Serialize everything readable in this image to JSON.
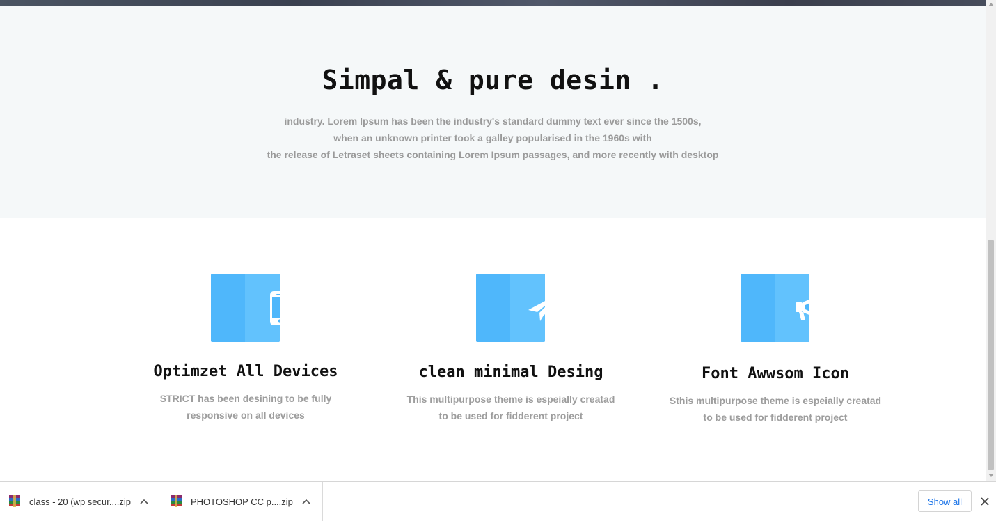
{
  "hero": {
    "title": "Simpal & pure desin .",
    "description": [
      "industry. Lorem Ipsum has been the industry's standard dummy text ever since the 1500s,",
      "when an unknown printer took a galley popularised in the 1960s with",
      "the release of Letraset sheets containing Lorem Ipsum passages, and more recently with desktop"
    ]
  },
  "features": [
    {
      "icon": "mobile-phone-icon",
      "title": "Optimzet All Devices",
      "lines": [
        "STRICT has been desining to be fully",
        "responsive on all devices"
      ]
    },
    {
      "icon": "paper-plane-icon",
      "title": "clean minimal Desing",
      "lines": [
        "This multipurpose theme is espeially creatad",
        "to be used for fidderent project"
      ]
    },
    {
      "icon": "bullhorn-icon",
      "title": "Font Awwsom Icon",
      "lines": [
        "Sthis multipurpose theme is espeially creatad",
        "to be used for fidderent project"
      ]
    }
  ],
  "colors": {
    "hero_bg": "#f5f8f9",
    "icon_box": "#4fb7fb",
    "icon_box_light": "#62c2fd",
    "text_muted": "#9a9a9a",
    "link_blue": "#1a73e8"
  },
  "downloads": {
    "items": [
      {
        "name": "class - 20 (wp secur....zip",
        "icon": "winrar-archive-icon"
      },
      {
        "name": "PHOTOSHOP CC p....zip",
        "icon": "winrar-archive-icon"
      }
    ],
    "show_all_label": "Show all"
  }
}
